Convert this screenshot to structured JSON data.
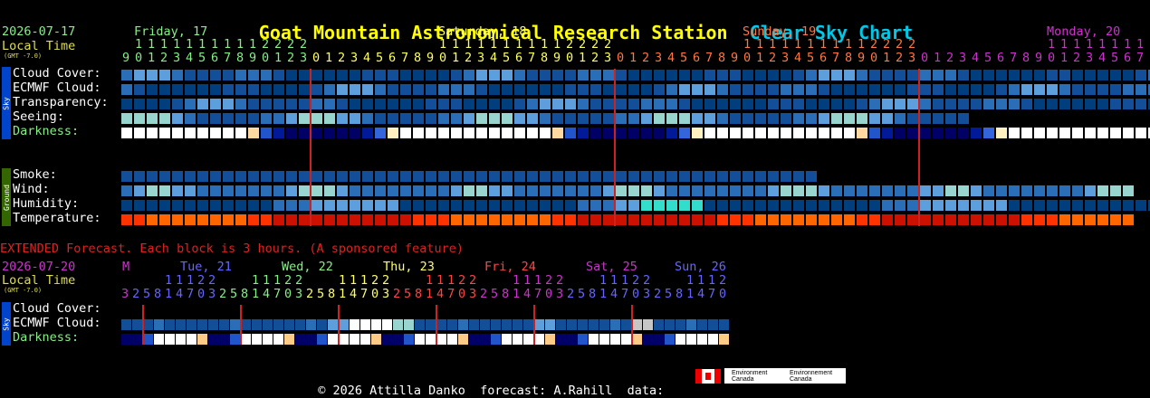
{
  "title": {
    "station": "Goat Mountain Astronomical Research Station",
    "chart": "Clear Sky Chart",
    "station_color": "#ffff00",
    "chart_color": "#00c8e6"
  },
  "header": {
    "date": "2026-07-17",
    "local_time": "Local Time",
    "gmt": "(GMT -7.0)"
  },
  "day_labels": [
    {
      "text": "Friday, 17",
      "color": "#88ee88"
    },
    {
      "text": "Saturday, 18",
      "color": "#ffff66"
    },
    {
      "text": "Sunday, 19",
      "color": "#ff7744"
    },
    {
      "text": "Monday, 20",
      "color": "#cc33cc"
    }
  ],
  "sections": {
    "sky": "Sky",
    "ground": "Ground"
  },
  "row_labels": {
    "cloud": "Cloud Cover:",
    "ecmwf": "ECMWF Cloud:",
    "transparency": "Transparency:",
    "seeing": "Seeing:",
    "darkness": "Darkness:",
    "smoke": "Smoke:",
    "wind": "Wind:",
    "humidity": "Humidity:",
    "temperature": "Temperature:"
  },
  "main_start_hour": 9,
  "main_cols": {
    "cloud": 85,
    "ecmwf": 85,
    "transparency": 85,
    "seeing": 67,
    "darkness": 85,
    "smoke": 55,
    "wind": 80,
    "humidity": 85,
    "temperature": 80
  },
  "extended": {
    "note": "EXTENDED Forecast. Each block is 3 hours. (A sponsored feature)",
    "date": "2026-07-20",
    "local_time": "Local Time",
    "gmt": "(GMT -7.0)",
    "day_labels": [
      {
        "text": "M",
        "color": "#cc33cc"
      },
      {
        "text": "Tue, 21",
        "color": "#6666ff"
      },
      {
        "text": "Wed, 22",
        "color": "#88ee88"
      },
      {
        "text": "Thu, 23",
        "color": "#ffff66"
      },
      {
        "text": "Fri, 24",
        "color": "#ff4444"
      },
      {
        "text": "Sat, 25",
        "color": "#cc33cc"
      },
      {
        "text": "Sun, 26",
        "color": "#6666ff"
      }
    ],
    "row_labels": {
      "cloud": "Cloud Cover:",
      "ecmwf": "ECMWF Cloud:",
      "darkness": "Darkness:"
    },
    "hours": [
      3,
      2,
      5,
      8,
      11,
      14,
      17,
      20,
      23,
      2,
      5,
      8,
      11,
      14,
      17,
      20,
      23,
      2,
      5,
      8,
      11,
      14,
      17,
      20,
      23,
      2,
      5,
      8,
      11,
      14,
      17,
      20,
      23,
      2,
      5,
      8,
      11,
      14,
      17,
      20,
      23,
      2,
      5,
      8,
      11,
      14,
      17,
      20,
      23,
      2,
      5,
      8,
      11,
      14,
      17,
      20
    ],
    "cols": 56
  },
  "footer": {
    "copyright": "© 2026 Attilla Danko",
    "forecast": "forecast: A.Rahill",
    "data": "data:",
    "env_en": "Environment Canada",
    "env_fr": "Environnement Canada"
  },
  "colors": {
    "dark_blue": "#003e7e",
    "mid_blue": "#134f98",
    "lt_blue": "#2a6eb8",
    "sky": "#5d9fdc",
    "cyan_grey": "#99d5cf",
    "white": "#ffffff",
    "grey": "#c6c6c6",
    "red_line": "#cc2222"
  }
}
